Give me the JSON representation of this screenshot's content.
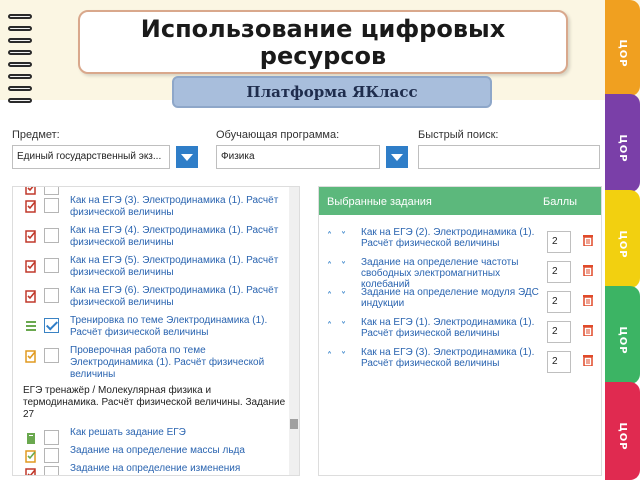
{
  "slide": {
    "title": "Использование цифровых ресурсов",
    "subtitle": "Платформа ЯКласс",
    "side_tabs": [
      {
        "label": "ЦОР",
        "color": "#f0a020"
      },
      {
        "label": "ЦОР",
        "color": "#7a3fa8"
      },
      {
        "label": "ЦОР",
        "color": "#f2d010"
      },
      {
        "label": "ЦОР",
        "color": "#3cb464"
      },
      {
        "label": "ЦОР",
        "color": "#e02a50"
      }
    ]
  },
  "filters": {
    "subject_label": "Предмет:",
    "subject_value": "Единый государственный экз...",
    "program_label": "Обучающая программа:",
    "program_value": "Физика",
    "search_label": "Быстрый поиск:",
    "search_value": ""
  },
  "task_list": {
    "items": [
      {
        "text": "физической величины",
        "icon": "exam-icon",
        "checked": false
      },
      {
        "text": "Как на ЕГЭ (3). Электродинамика (1). Расчёт физической величины",
        "icon": "exam-icon",
        "checked": false
      },
      {
        "text": "Как на ЕГЭ (4). Электродинамика (1). Расчёт физической величины",
        "icon": "exam-icon",
        "checked": false
      },
      {
        "text": "Как на ЕГЭ (5). Электродинамика (1). Расчёт физической величины",
        "icon": "exam-icon",
        "checked": false
      },
      {
        "text": "Как на ЕГЭ (6). Электродинамика (1). Расчёт физической величины",
        "icon": "exam-icon",
        "checked": false
      },
      {
        "text": "Тренировка по теме Электродинамика (1). Расчёт физической величины",
        "icon": "training-icon",
        "checked": true
      },
      {
        "text": "Проверочная работа по теме Электродинамика (1). Расчёт физической величины",
        "icon": "test-icon",
        "checked": false
      }
    ],
    "group_heading": "ЕГЭ тренажёр / Молекулярная физика и термодинамика. Расчёт физической величины. Задание 27",
    "group_items": [
      {
        "text": "Как решать задание ЕГЭ",
        "icon": "theory-icon",
        "checked": false
      },
      {
        "text": "Задание на определение массы льда",
        "icon": "exercise-icon",
        "checked": false
      },
      {
        "text": "Задание на определение изменения",
        "icon": "exam-icon",
        "checked": false
      }
    ]
  },
  "selected_panel": {
    "header_title": "Выбранные задания",
    "header_score": "Баллы",
    "items": [
      {
        "text": "Как на ЕГЭ (2). Электродинамика (1). Расчёт физической величины",
        "score": "2"
      },
      {
        "text": "Задание на определение частоты свободных электромагнитных колебаний",
        "score": "2"
      },
      {
        "text": "Задание на определение модуля ЭДС индукции",
        "score": "2"
      },
      {
        "text": "Как на ЕГЭ (1). Электродинамика (1). Расчёт физической величины",
        "score": "2"
      },
      {
        "text": "Как на ЕГЭ (3). Электродинамика (1). Расчёт физической величины",
        "score": "2"
      }
    ]
  },
  "colors": {
    "accent_blue": "#2f7ec8",
    "header_green": "#5cb87c",
    "link_blue": "#2a64b0",
    "delete_red": "#e04a2a"
  }
}
